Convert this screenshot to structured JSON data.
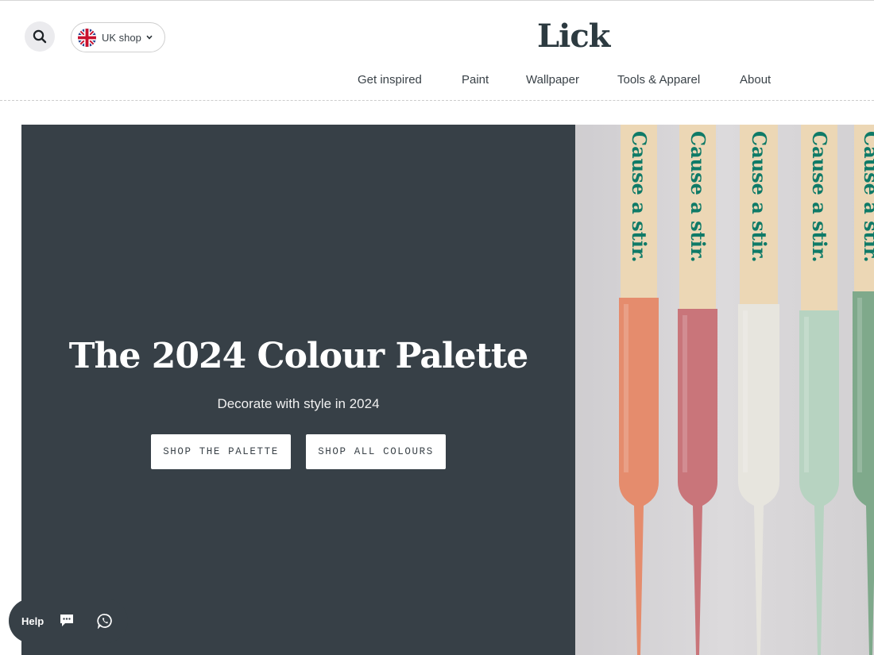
{
  "header": {
    "shop_selector": {
      "label": "UK shop"
    },
    "logo": "Lick"
  },
  "nav": {
    "items": [
      {
        "label": "Get inspired"
      },
      {
        "label": "Paint"
      },
      {
        "label": "Wallpaper"
      },
      {
        "label": "Tools & Apparel"
      },
      {
        "label": "About"
      }
    ]
  },
  "hero": {
    "title": "The 2024 Colour Palette",
    "subtitle": "Decorate with style in 2024",
    "buttons": [
      {
        "label": "SHOP THE PALETTE"
      },
      {
        "label": "SHOP ALL COLOURS"
      }
    ],
    "image": {
      "stick_text": "Cause a stir.",
      "paint_colors": [
        "#e58c6d",
        "#c9757a",
        "#e7e5de",
        "#b7d3c1",
        "#7fa98b"
      ]
    }
  },
  "help_widget": {
    "label": "Help",
    "icons": [
      "chat-icon",
      "whatsapp-icon"
    ]
  },
  "colors": {
    "hero_background": "#374047",
    "logo": "#2c3a40",
    "stick_text": "#0f7a67"
  }
}
